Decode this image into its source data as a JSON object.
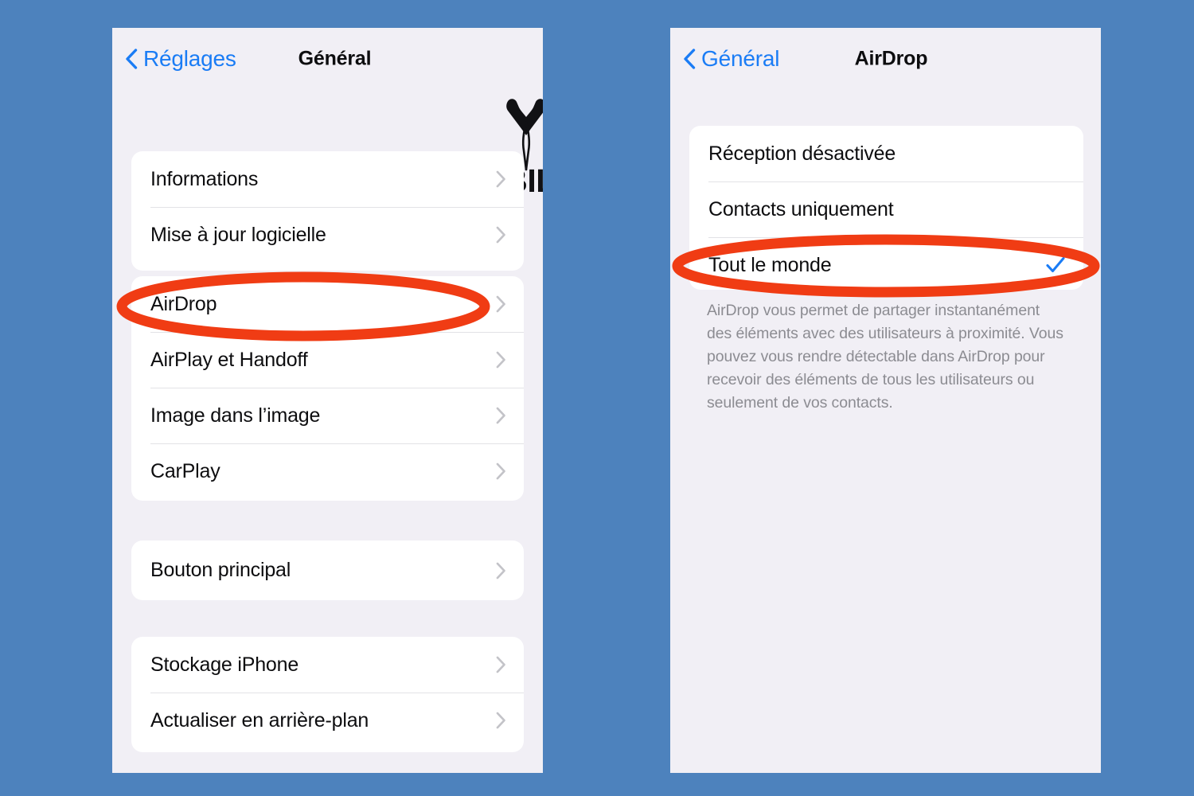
{
  "background_color": "#4d82bd",
  "accent_blue": "#1a7cf5",
  "annotation_color": "#f03c14",
  "brand": {
    "name": "MOBILAX",
    "mark_icon": "tweezers-icon"
  },
  "left_screen": {
    "nav": {
      "back_label": "Réglages",
      "back_icon": "chevron-left-icon",
      "title": "Général"
    },
    "groups": [
      {
        "rows": [
          {
            "label": "Informations",
            "accessory": "chevron-right-icon"
          },
          {
            "label": "Mise à jour logicielle",
            "accessory": "chevron-right-icon"
          }
        ]
      },
      {
        "rows": [
          {
            "label": "AirDrop",
            "accessory": "chevron-right-icon"
          },
          {
            "label": "AirPlay et Handoff",
            "accessory": "chevron-right-icon"
          },
          {
            "label": "Image dans l’image",
            "accessory": "chevron-right-icon"
          },
          {
            "label": "CarPlay",
            "accessory": "chevron-right-icon"
          }
        ]
      },
      {
        "rows": [
          {
            "label": "Bouton principal",
            "accessory": "chevron-right-icon"
          }
        ]
      },
      {
        "rows": [
          {
            "label": "Stockage iPhone",
            "accessory": "chevron-right-icon"
          },
          {
            "label": "Actualiser en arrière-plan",
            "accessory": "chevron-right-icon"
          }
        ]
      }
    ],
    "highlight": "AirDrop"
  },
  "right_screen": {
    "nav": {
      "back_label": "Général",
      "back_icon": "chevron-left-icon",
      "title": "AirDrop"
    },
    "options": [
      {
        "label": "Réception désactivée",
        "selected": false
      },
      {
        "label": "Contacts uniquement",
        "selected": false
      },
      {
        "label": "Tout le monde",
        "selected": true,
        "accessory": "checkmark-icon"
      }
    ],
    "footnote": "AirDrop vous permet de partager instantanément des éléments avec des utilisateurs à proximité. Vous pouvez vous rendre détectable dans AirDrop pour recevoir des éléments de tous les utilisateurs ou seulement de vos contacts.",
    "highlight": "Tout le monde"
  }
}
